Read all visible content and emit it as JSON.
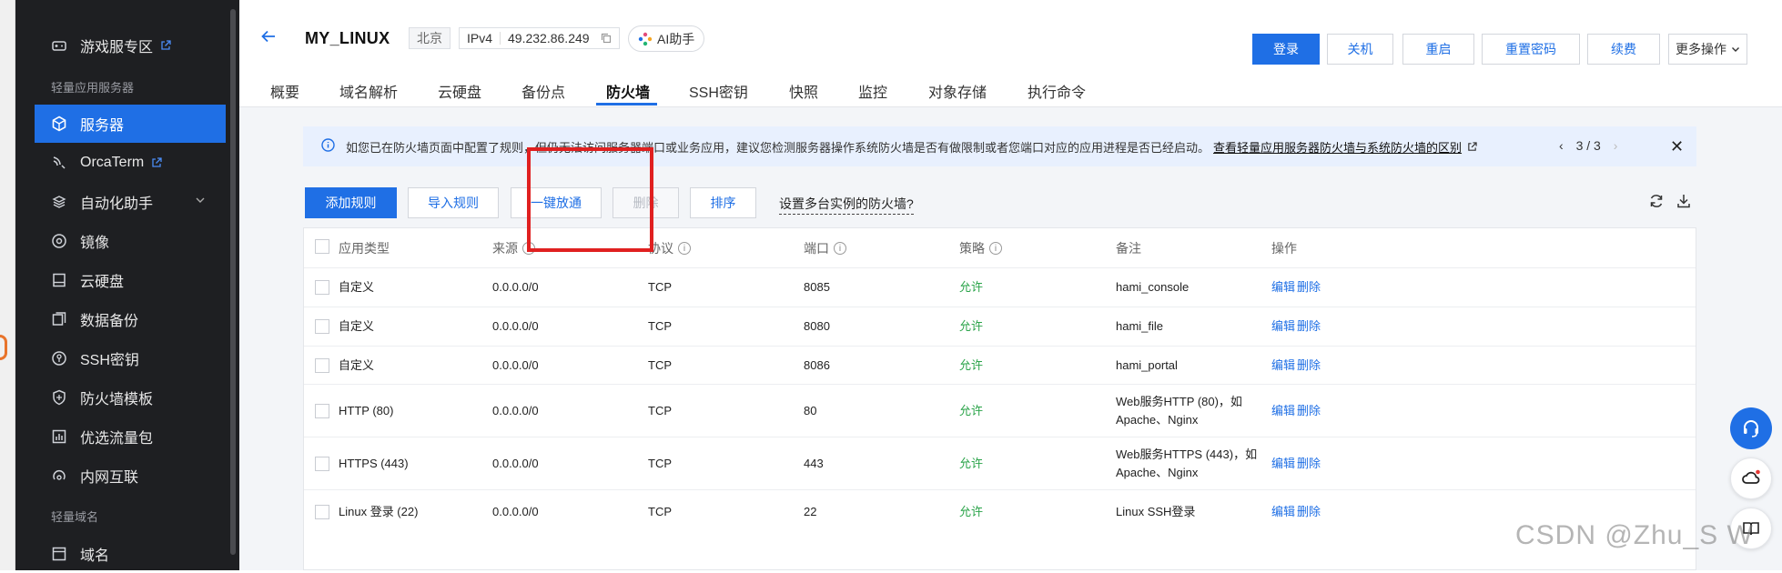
{
  "sidebar": {
    "items": [
      {
        "label": "游戏服专区",
        "icon": "gamepad-icon"
      },
      {
        "label": "服务器",
        "icon": "cube-icon"
      },
      {
        "label": "OrcaTerm",
        "icon": "terminal-icon"
      },
      {
        "label": "自动化助手",
        "icon": "robot-icon"
      },
      {
        "label": "镜像",
        "icon": "disc-icon"
      },
      {
        "label": "云硬盘",
        "icon": "disk-icon"
      },
      {
        "label": "数据备份",
        "icon": "backup-icon"
      },
      {
        "label": "SSH密钥",
        "icon": "key-icon"
      },
      {
        "label": "防火墙模板",
        "icon": "shield-icon"
      },
      {
        "label": "优选流量包",
        "icon": "chart-icon"
      },
      {
        "label": "内网互联",
        "icon": "link-icon"
      },
      {
        "label": "域名",
        "icon": "domain-icon"
      }
    ],
    "groups": [
      "轻量应用服务器",
      "轻量域名"
    ]
  },
  "header": {
    "title": "MY_LINUX",
    "region": "北京",
    "ip_type": "IPv4",
    "ip": "49.232.86.249",
    "ai_label": "AI助手",
    "buttons": {
      "login": "登录",
      "shutdown": "关机",
      "restart": "重启",
      "reset_password": "重置密码",
      "renew": "续费",
      "more": "更多操作"
    }
  },
  "tabs": [
    "概要",
    "域名解析",
    "云硬盘",
    "备份点",
    "防火墙",
    "SSH密钥",
    "快照",
    "监控",
    "对象存储",
    "执行命令"
  ],
  "active_tab": "防火墙",
  "notice": {
    "text": "如您已在防火墙页面中配置了规则，但仍无法访问服务器端口或业务应用，建议您检测服务器操作系统防火墙是否有做限制或者您端口对应的应用进程是否已经启动。",
    "link": "查看轻量应用服务器防火墙与系统防火墙的区别",
    "pager": "3 / 3"
  },
  "toolbar": {
    "add_rule": "添加规则",
    "import_rules": "导入规则",
    "one_click_allow": "一键放通",
    "delete": "删除",
    "sort": "排序",
    "help_link": "设置多台实例的防火墙?"
  },
  "table": {
    "headers": [
      "应用类型",
      "来源",
      "协议",
      "端口",
      "策略",
      "备注",
      "操作"
    ],
    "rows": [
      {
        "app": "自定义",
        "source": "0.0.0.0/0",
        "protocol": "TCP",
        "port": "8085",
        "policy": "允许",
        "note": [
          "hami_console"
        ]
      },
      {
        "app": "自定义",
        "source": "0.0.0.0/0",
        "protocol": "TCP",
        "port": "8080",
        "policy": "允许",
        "note": [
          "hami_file"
        ]
      },
      {
        "app": "自定义",
        "source": "0.0.0.0/0",
        "protocol": "TCP",
        "port": "8086",
        "policy": "允许",
        "note": [
          "hami_portal"
        ]
      },
      {
        "app": "HTTP (80)",
        "source": "0.0.0.0/0",
        "protocol": "TCP",
        "port": "80",
        "policy": "允许",
        "note": [
          "Web服务HTTP (80)，如",
          "Apache、Nginx"
        ]
      },
      {
        "app": "HTTPS (443)",
        "source": "0.0.0.0/0",
        "protocol": "TCP",
        "port": "443",
        "policy": "允许",
        "note": [
          "Web服务HTTPS (443)，如",
          "Apache、Nginx"
        ]
      },
      {
        "app": "Linux 登录 (22)",
        "source": "0.0.0.0/0",
        "protocol": "TCP",
        "port": "22",
        "policy": "允许",
        "note": [
          "Linux SSH登录"
        ]
      }
    ],
    "edit_label": "编辑",
    "delete_label": "删除"
  },
  "watermark": "CSDN @Zhu_S W"
}
